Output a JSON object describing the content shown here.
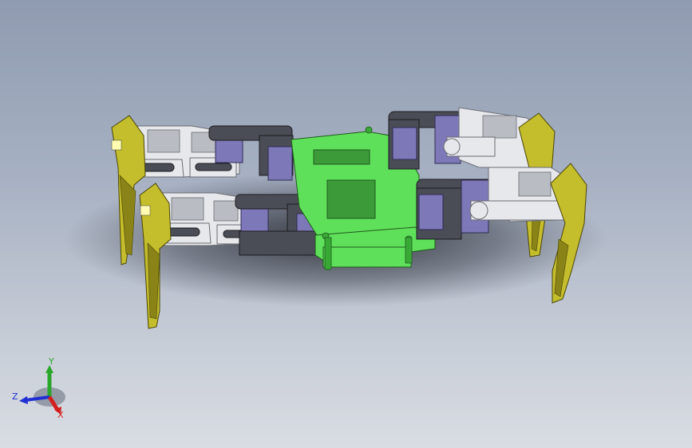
{
  "viewport": {
    "background_top": "#8f9bb0",
    "background_bottom": "#d9dde3"
  },
  "model": {
    "parts": {
      "chassis_color": "#5fe05a",
      "chassis_shade": "#39a936",
      "servo_color": "#7d78b8",
      "servo_shade": "#55528e",
      "bracket_color": "#4a4d55",
      "link_color": "#e6e8ec",
      "foot_color": "#c4bd2c",
      "foot_shade": "#8a8317"
    }
  },
  "triad": {
    "x_label": "X",
    "y_label": "Y",
    "z_label": "Z",
    "x_color": "#d41f1f",
    "y_color": "#2aa62a",
    "z_color": "#1f2fd4"
  }
}
